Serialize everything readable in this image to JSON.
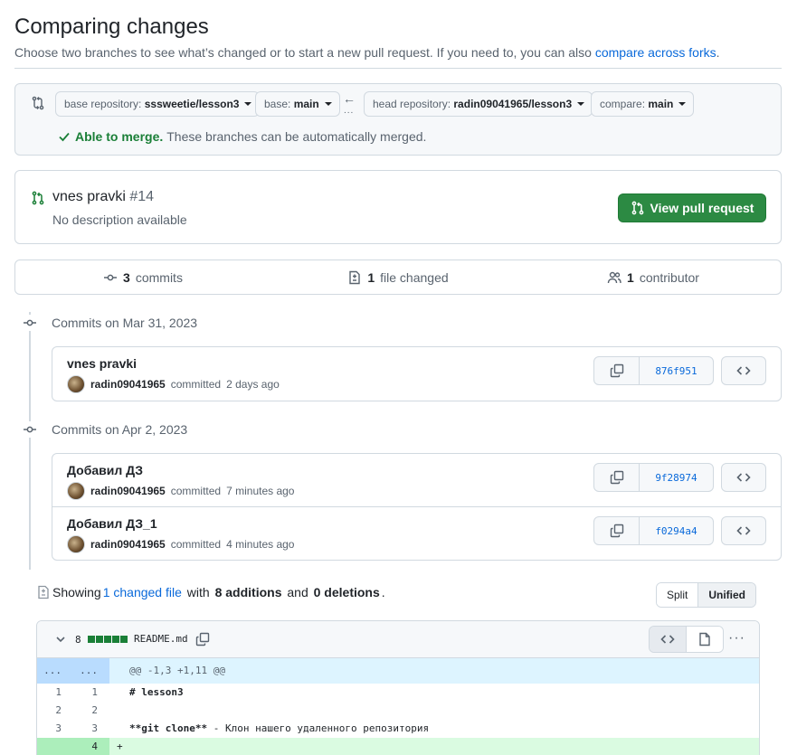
{
  "page": {
    "title": "Comparing changes",
    "subtitle_pre": "Choose two branches to see what’s changed or to start a new pull request. If you need to, you can also ",
    "subtitle_link": "compare across forks",
    "subtitle_post": "."
  },
  "range": {
    "base_repo_label": "base repository: ",
    "base_repo": "sssweetie/lesson3",
    "base_label": "base: ",
    "base": "main",
    "head_repo_label": "head repository: ",
    "head_repo": "radin09041965/lesson3",
    "compare_label": "compare: ",
    "compare": "main",
    "arrow": "←",
    "dots": "...",
    "merge_status": "Able to merge.",
    "merge_text": "These branches can be automatically merged."
  },
  "pr": {
    "title": "vnes pravki",
    "number": "#14",
    "description": "No description available",
    "button": "View pull request"
  },
  "stats": {
    "commits_n": "3",
    "commits_label": "commits",
    "files_n": "1",
    "files_label": "file changed",
    "contrib_n": "1",
    "contrib_label": "contributor"
  },
  "groups": [
    {
      "date": "Commits on Mar 31, 2023",
      "commits": [
        {
          "message": "vnes pravki",
          "author": "radin09041965",
          "action": "committed",
          "time": "2 days ago",
          "sha": "876f951"
        }
      ]
    },
    {
      "date": "Commits on Apr 2, 2023",
      "commits": [
        {
          "message": "Добавил ДЗ",
          "author": "radin09041965",
          "action": "committed",
          "time": "7 minutes ago",
          "sha": "9f28974"
        },
        {
          "message": "Добавил ДЗ_1",
          "author": "radin09041965",
          "action": "committed",
          "time": "4 minutes ago",
          "sha": "f0294a4"
        }
      ]
    }
  ],
  "summary": {
    "pre": "Showing ",
    "link": "1 changed file",
    "mid1": " with ",
    "additions": "8 additions",
    "mid2": " and ",
    "deletions": "0 deletions",
    "post": "."
  },
  "view": {
    "split": "Split",
    "unified": "Unified"
  },
  "file": {
    "count": "8",
    "name": "README.md",
    "more": "···"
  },
  "diff": {
    "hunk": {
      "n1": "...",
      "n2": "...",
      "code": "@@ -1,3 +1,11 @@"
    },
    "lines": [
      {
        "n1": "1",
        "n2": "1",
        "code": "# lesson3"
      },
      {
        "n1": "2",
        "n2": "2",
        "code": ""
      },
      {
        "n1": "3",
        "n2": "3",
        "code_bold": "**git clone**",
        "code_rest": " - Клон нашего удаленного репозитория"
      },
      {
        "n1": "",
        "n2": "4",
        "code": "+"
      }
    ]
  }
}
